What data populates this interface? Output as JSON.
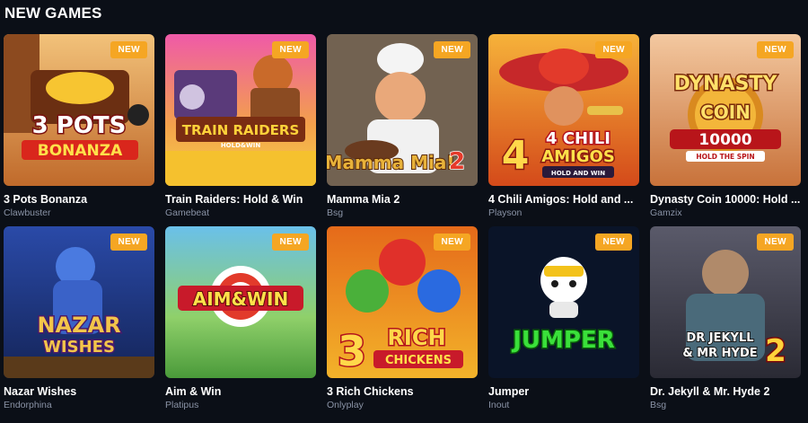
{
  "section": {
    "title": "NEW GAMES"
  },
  "badge_label": "NEW",
  "games": [
    {
      "title": "3 Pots Bonanza",
      "provider": "Clawbuster",
      "logo_line1": "3 POTS",
      "logo_line2": "BONANZA"
    },
    {
      "title": "Train Raiders: Hold & Win",
      "provider": "Gamebeat",
      "logo_line1": "TRAIN RAIDERS",
      "logo_line2": "HOLD&WIN"
    },
    {
      "title": "Mamma Mia 2",
      "provider": "Bsg",
      "logo_line1": "Mamma Mia!",
      "logo_line2": "2"
    },
    {
      "title": "4 Chili Amigos: Hold and ...",
      "provider": "Playson",
      "logo_line1": "4 CHILI",
      "logo_line2": "AMIGOS",
      "logo_line3": "HOLD AND WIN"
    },
    {
      "title": "Dynasty Coin 10000: Hold ...",
      "provider": "Gamzix",
      "logo_line1": "DYNASTY",
      "logo_line2": "COIN",
      "logo_line3": "10000",
      "logo_line4": "HOLD THE SPIN"
    },
    {
      "title": "Nazar Wishes",
      "provider": "Endorphina",
      "logo_line1": "NAZAR",
      "logo_line2": "WISHES"
    },
    {
      "title": "Aim & Win",
      "provider": "Platipus",
      "logo_line1": "AIM&WIN"
    },
    {
      "title": "3 Rich Chickens",
      "provider": "Onlyplay",
      "logo_line1": "3 RICH",
      "logo_line2": "CHICKENS"
    },
    {
      "title": "Jumper",
      "provider": "Inout",
      "logo_line1": "JUMPER"
    },
    {
      "title": "Dr. Jekyll & Mr. Hyde 2",
      "provider": "Bsg",
      "logo_line1": "DR JEKYLL",
      "logo_line2": "& MR HYDE",
      "logo_line3": "2"
    }
  ],
  "colors": {
    "background": "#0b0f17",
    "badge": "#f5a623",
    "provider_text": "#8a93a6"
  }
}
